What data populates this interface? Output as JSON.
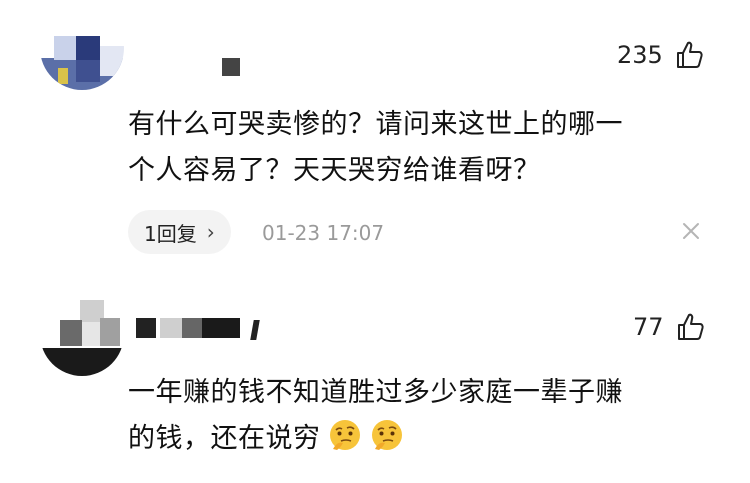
{
  "comments": [
    {
      "likes": "235",
      "text_line1": "有什么可哭卖惨的？请问来这世上的哪一",
      "text_line2": "个人容易了？天天哭穷给谁看呀？",
      "reply_label": "1回复",
      "reply_chevron": "›",
      "timestamp": "01-23 17:07",
      "close_icon": "close-icon"
    },
    {
      "likes": "77",
      "text_line1": "一年赚的钱不知道胜过多少家庭一辈子赚",
      "text_line2": "的钱，还在说穷",
      "emoji_icon": "thinking-face-emoji"
    }
  ],
  "colors": {
    "text": "#111111",
    "muted": "#9a9a9a",
    "pill": "#f3f3f3"
  }
}
